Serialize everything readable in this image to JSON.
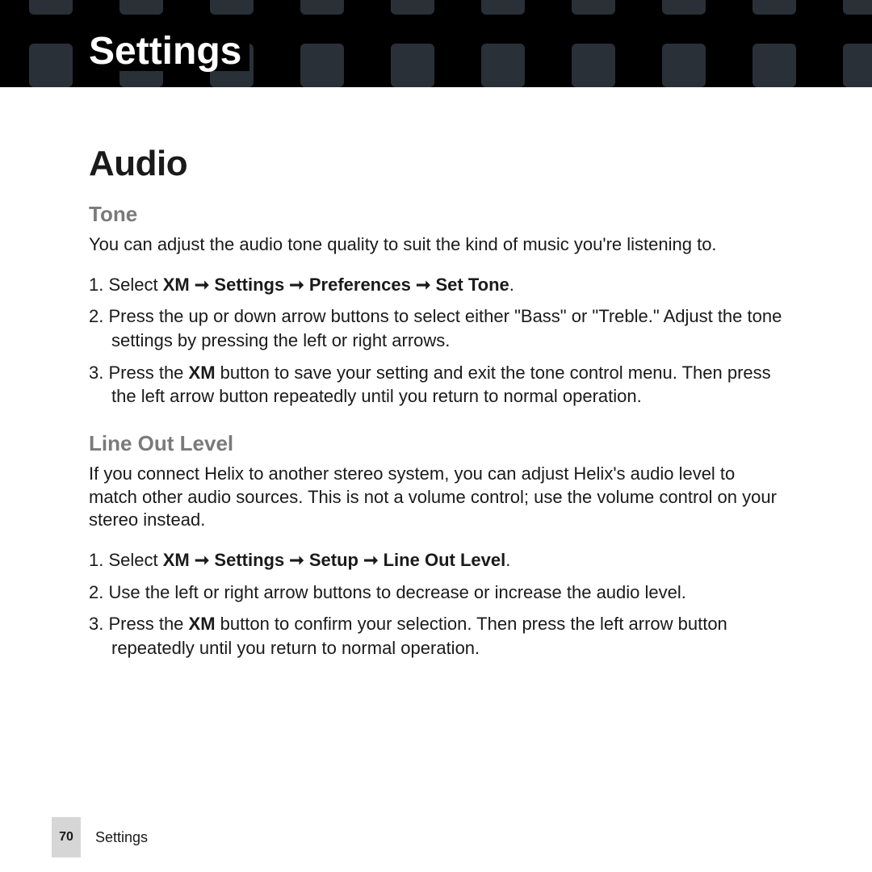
{
  "header": {
    "title": "Settings"
  },
  "section": {
    "title": "Audio"
  },
  "tone": {
    "heading": "Tone",
    "intro": "You can adjust the audio tone quality to suit the kind of music you're listening to.",
    "step1_prefix": "Select ",
    "step1_bold": "XM ➞ Settings ➞ Preferences ➞ Set Tone",
    "step1_suffix": ".",
    "step2": "Press the up or down arrow buttons to select either \"Bass\" or \"Treble.\" Adjust the tone settings by pressing the left or right arrows.",
    "step3_prefix": "Press the ",
    "step3_bold": "XM",
    "step3_suffix": " button to save your setting and exit the tone control menu. Then press the left arrow button repeatedly until you return to normal operation."
  },
  "lineout": {
    "heading": "Line Out Level",
    "intro": "If you connect Helix to another stereo system, you can adjust Helix's audio level to match other audio sources. This is not a volume control; use the volume control on your stereo instead.",
    "step1_prefix": "Select ",
    "step1_bold": "XM ➞ Settings ➞ Setup ➞ Line Out Level",
    "step1_suffix": ".",
    "step2": "Use the left or right arrow buttons to decrease or increase the audio level.",
    "step3_prefix": "Press the ",
    "step3_bold": "XM",
    "step3_suffix": " button to confirm your selection. Then press the left arrow button repeatedly until you return to normal operation."
  },
  "footer": {
    "page": "70",
    "label": "Settings"
  }
}
